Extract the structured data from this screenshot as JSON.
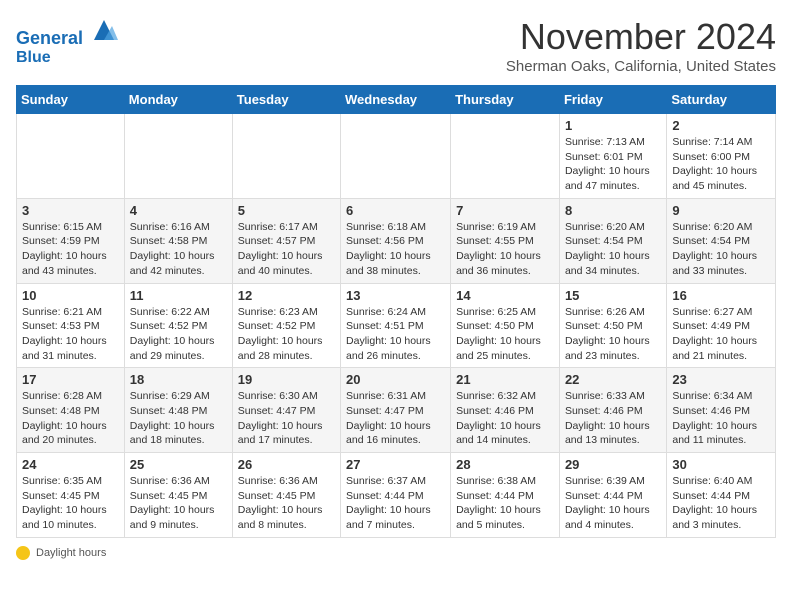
{
  "header": {
    "logo_line1": "General",
    "logo_line2": "Blue",
    "month": "November 2024",
    "location": "Sherman Oaks, California, United States"
  },
  "days_of_week": [
    "Sunday",
    "Monday",
    "Tuesday",
    "Wednesday",
    "Thursday",
    "Friday",
    "Saturday"
  ],
  "weeks": [
    [
      {
        "day": "",
        "info": ""
      },
      {
        "day": "",
        "info": ""
      },
      {
        "day": "",
        "info": ""
      },
      {
        "day": "",
        "info": ""
      },
      {
        "day": "",
        "info": ""
      },
      {
        "day": "1",
        "info": "Sunrise: 7:13 AM\nSunset: 6:01 PM\nDaylight: 10 hours and 47 minutes."
      },
      {
        "day": "2",
        "info": "Sunrise: 7:14 AM\nSunset: 6:00 PM\nDaylight: 10 hours and 45 minutes."
      }
    ],
    [
      {
        "day": "3",
        "info": "Sunrise: 6:15 AM\nSunset: 4:59 PM\nDaylight: 10 hours and 43 minutes."
      },
      {
        "day": "4",
        "info": "Sunrise: 6:16 AM\nSunset: 4:58 PM\nDaylight: 10 hours and 42 minutes."
      },
      {
        "day": "5",
        "info": "Sunrise: 6:17 AM\nSunset: 4:57 PM\nDaylight: 10 hours and 40 minutes."
      },
      {
        "day": "6",
        "info": "Sunrise: 6:18 AM\nSunset: 4:56 PM\nDaylight: 10 hours and 38 minutes."
      },
      {
        "day": "7",
        "info": "Sunrise: 6:19 AM\nSunset: 4:55 PM\nDaylight: 10 hours and 36 minutes."
      },
      {
        "day": "8",
        "info": "Sunrise: 6:20 AM\nSunset: 4:54 PM\nDaylight: 10 hours and 34 minutes."
      },
      {
        "day": "9",
        "info": "Sunrise: 6:20 AM\nSunset: 4:54 PM\nDaylight: 10 hours and 33 minutes."
      }
    ],
    [
      {
        "day": "10",
        "info": "Sunrise: 6:21 AM\nSunset: 4:53 PM\nDaylight: 10 hours and 31 minutes."
      },
      {
        "day": "11",
        "info": "Sunrise: 6:22 AM\nSunset: 4:52 PM\nDaylight: 10 hours and 29 minutes."
      },
      {
        "day": "12",
        "info": "Sunrise: 6:23 AM\nSunset: 4:52 PM\nDaylight: 10 hours and 28 minutes."
      },
      {
        "day": "13",
        "info": "Sunrise: 6:24 AM\nSunset: 4:51 PM\nDaylight: 10 hours and 26 minutes."
      },
      {
        "day": "14",
        "info": "Sunrise: 6:25 AM\nSunset: 4:50 PM\nDaylight: 10 hours and 25 minutes."
      },
      {
        "day": "15",
        "info": "Sunrise: 6:26 AM\nSunset: 4:50 PM\nDaylight: 10 hours and 23 minutes."
      },
      {
        "day": "16",
        "info": "Sunrise: 6:27 AM\nSunset: 4:49 PM\nDaylight: 10 hours and 21 minutes."
      }
    ],
    [
      {
        "day": "17",
        "info": "Sunrise: 6:28 AM\nSunset: 4:48 PM\nDaylight: 10 hours and 20 minutes."
      },
      {
        "day": "18",
        "info": "Sunrise: 6:29 AM\nSunset: 4:48 PM\nDaylight: 10 hours and 18 minutes."
      },
      {
        "day": "19",
        "info": "Sunrise: 6:30 AM\nSunset: 4:47 PM\nDaylight: 10 hours and 17 minutes."
      },
      {
        "day": "20",
        "info": "Sunrise: 6:31 AM\nSunset: 4:47 PM\nDaylight: 10 hours and 16 minutes."
      },
      {
        "day": "21",
        "info": "Sunrise: 6:32 AM\nSunset: 4:46 PM\nDaylight: 10 hours and 14 minutes."
      },
      {
        "day": "22",
        "info": "Sunrise: 6:33 AM\nSunset: 4:46 PM\nDaylight: 10 hours and 13 minutes."
      },
      {
        "day": "23",
        "info": "Sunrise: 6:34 AM\nSunset: 4:46 PM\nDaylight: 10 hours and 11 minutes."
      }
    ],
    [
      {
        "day": "24",
        "info": "Sunrise: 6:35 AM\nSunset: 4:45 PM\nDaylight: 10 hours and 10 minutes."
      },
      {
        "day": "25",
        "info": "Sunrise: 6:36 AM\nSunset: 4:45 PM\nDaylight: 10 hours and 9 minutes."
      },
      {
        "day": "26",
        "info": "Sunrise: 6:36 AM\nSunset: 4:45 PM\nDaylight: 10 hours and 8 minutes."
      },
      {
        "day": "27",
        "info": "Sunrise: 6:37 AM\nSunset: 4:44 PM\nDaylight: 10 hours and 7 minutes."
      },
      {
        "day": "28",
        "info": "Sunrise: 6:38 AM\nSunset: 4:44 PM\nDaylight: 10 hours and 5 minutes."
      },
      {
        "day": "29",
        "info": "Sunrise: 6:39 AM\nSunset: 4:44 PM\nDaylight: 10 hours and 4 minutes."
      },
      {
        "day": "30",
        "info": "Sunrise: 6:40 AM\nSunset: 4:44 PM\nDaylight: 10 hours and 3 minutes."
      }
    ]
  ],
  "footer": {
    "label": "Daylight hours"
  }
}
